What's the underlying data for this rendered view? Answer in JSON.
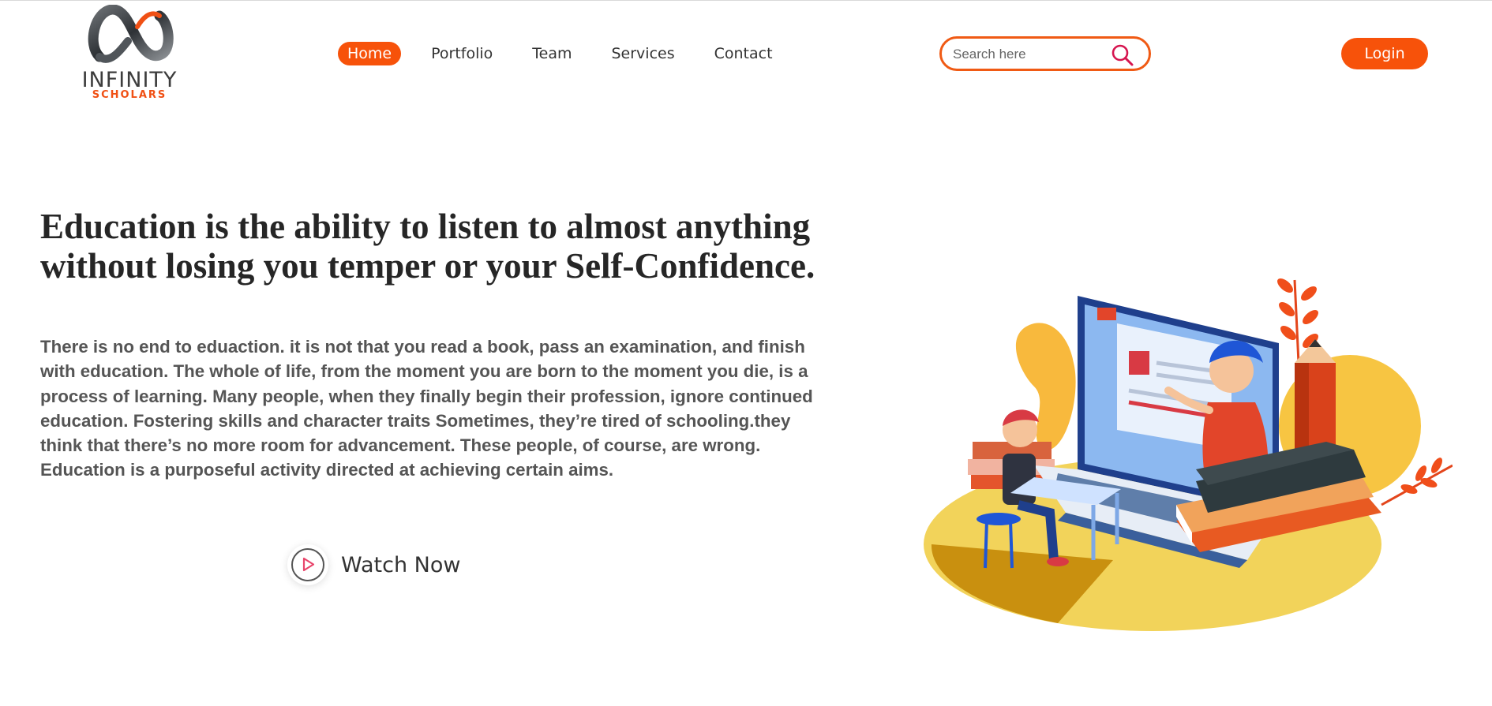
{
  "brand": {
    "name": "INFINITY",
    "subtitle": "SCHOLARS",
    "accent": "#f7520a"
  },
  "nav": {
    "items": [
      {
        "label": "Home",
        "active": true
      },
      {
        "label": "Portfolio",
        "active": false
      },
      {
        "label": "Team",
        "active": false
      },
      {
        "label": "Services",
        "active": false
      },
      {
        "label": "Contact",
        "active": false
      }
    ]
  },
  "search": {
    "placeholder": "Search here",
    "value": "",
    "icon": "search-icon"
  },
  "header": {
    "login_label": "Login"
  },
  "hero": {
    "headline_line1": "Education is the ability to listen to almost anything",
    "headline_line2": "without losing you temper or your Self-Confidence.",
    "paragraph_lines": [
      "There is no end to eduaction. it is not that you read a book, pass an examination, and finish",
      "with education. The whole of life, from the moment you are born to the moment you die, is a",
      "process of learning. Many people, when they finally begin their profession, ignore continued",
      "education. Fostering skills and character traits Sometimes, they’re tired of schooling.they",
      "think that there’s no more room for advancement. These people, of course, are wrong.",
      "Education is a purposeful activity directed at achieving certain aims."
    ],
    "watch_label": "Watch Now",
    "watch_icon": "play-icon"
  },
  "illustration": {
    "icon": "education-illustration"
  }
}
